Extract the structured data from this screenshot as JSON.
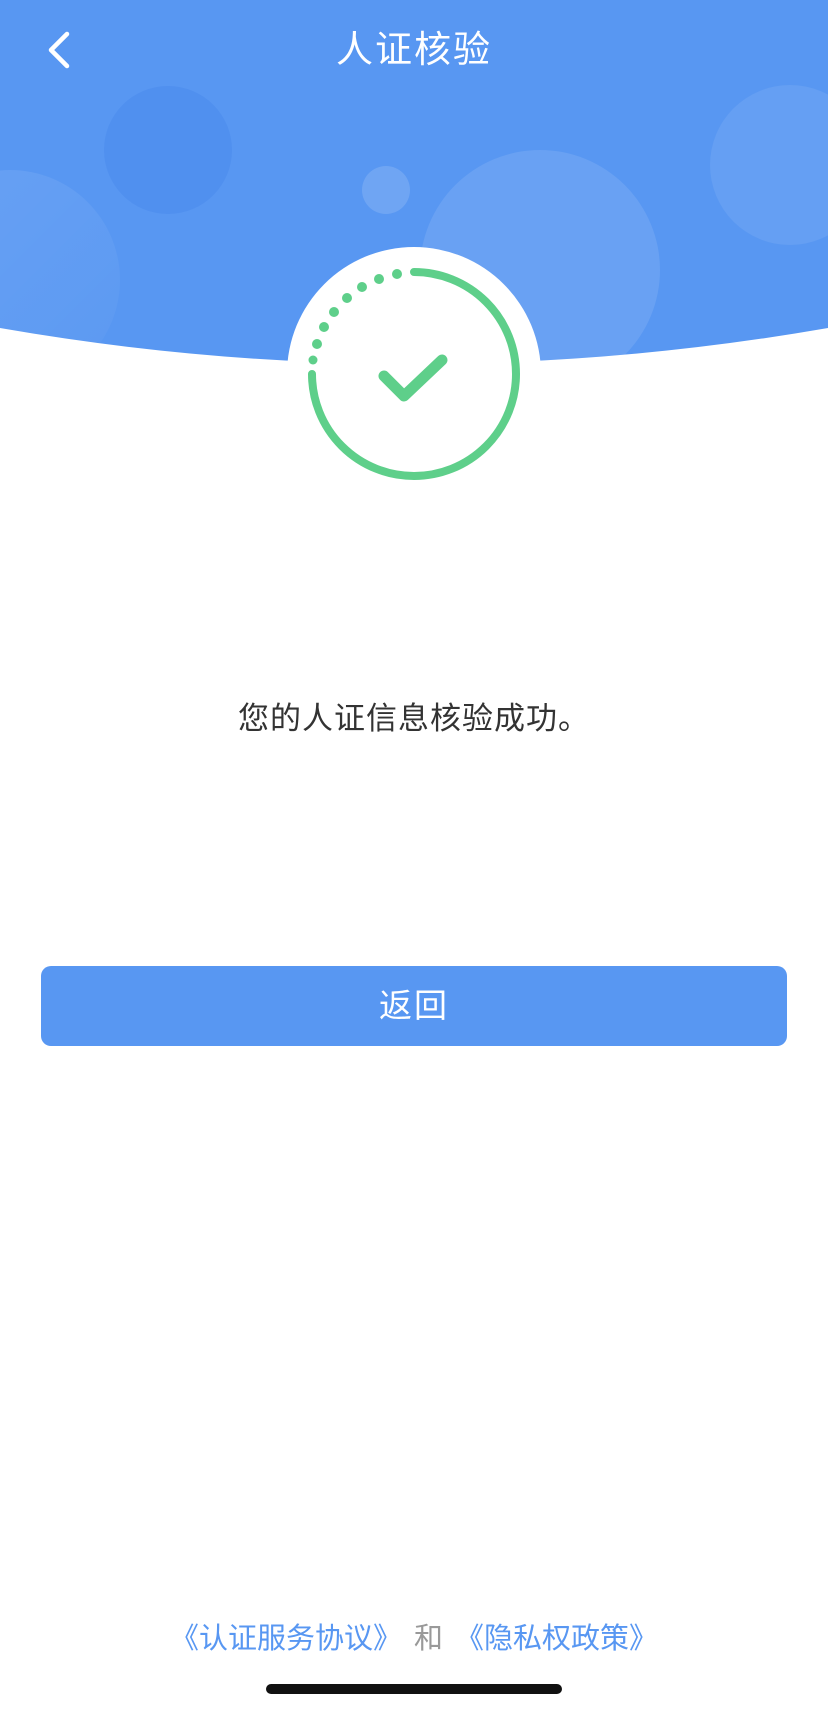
{
  "header": {
    "title": "人证核验",
    "back_icon": "chevron-left-icon",
    "background_color": "#5897f2"
  },
  "badge": {
    "icon": "checkmark-icon",
    "color": "#5ecf8a"
  },
  "message": {
    "text": "您的人证信息核验成功。"
  },
  "actions": {
    "return_label": "返回",
    "button_color": "#5897f2"
  },
  "footer": {
    "agreement_link": "《认证服务协议》",
    "conjunction": "和",
    "privacy_link": "《隐私权政策》",
    "link_color": "#5897f2"
  }
}
